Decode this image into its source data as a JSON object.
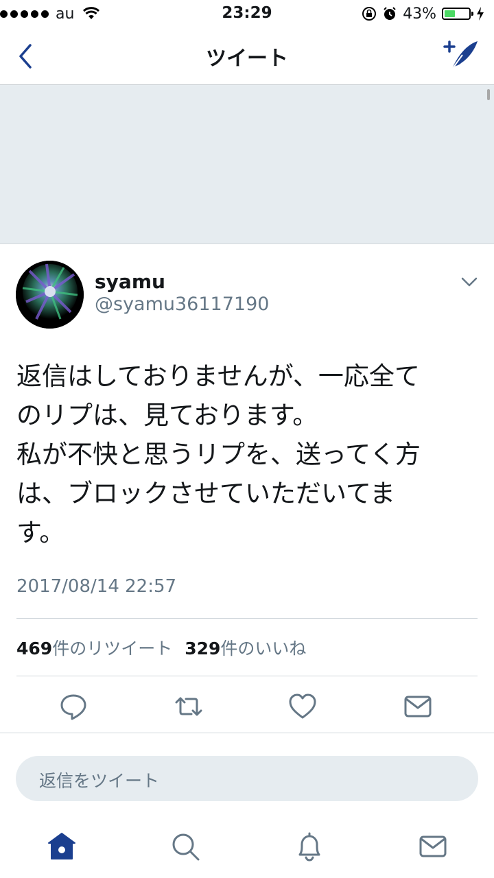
{
  "status_bar": {
    "carrier": "au",
    "time": "23:29",
    "battery_percent": "43%",
    "battery_level": 0.43
  },
  "nav": {
    "title": "ツイート",
    "back_icon": "chevron-left-icon",
    "compose_icon": "compose-tweet-icon"
  },
  "tweet": {
    "name": "syamu",
    "handle": "@syamu36117190",
    "text_lines": [
      "返信はしておりませんが、一応全て",
      "のリプは、見ております。",
      "私が不快と思うリプを、送ってく方",
      "は、ブロックさせていただいてま",
      "す。"
    ],
    "timestamp": "2017/08/14 22:57",
    "retweet_count": "469",
    "retweet_label": "件のリツイート",
    "like_count": "329",
    "like_label": "件のいいね"
  },
  "actions": [
    "reply-icon",
    "retweet-icon",
    "like-icon",
    "dm-icon"
  ],
  "reply": {
    "placeholder": "返信をツイート"
  },
  "tab_bar": [
    "home-icon",
    "search-icon",
    "notifications-icon",
    "messages-icon"
  ],
  "colors": {
    "accent": "#1b3f8f",
    "text": "#14171a",
    "secondary": "#657786",
    "gray_bg": "#e6ecf0"
  }
}
